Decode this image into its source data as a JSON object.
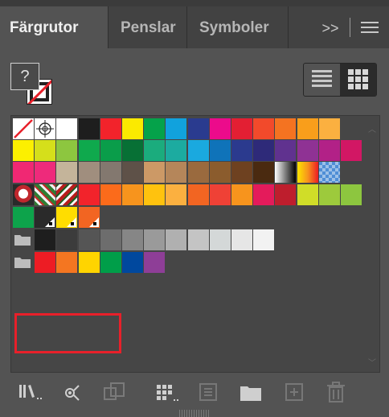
{
  "tabs": [
    {
      "label": "Färgrutor",
      "active": true
    },
    {
      "label": "Penslar",
      "active": false
    },
    {
      "label": "Symboler",
      "active": false
    }
  ],
  "overflow_label": ">>",
  "fill_stroke": {
    "unknown_fill_label": "?"
  },
  "view": {
    "list": "list-view-icon",
    "grid": "grid-view-icon",
    "selected": "grid"
  },
  "swatch_rows": [
    [
      "#none",
      "#registration",
      "#ffffff",
      "#1e1e1e",
      "#f2232b",
      "#fbea00",
      "#05a24a",
      "#11a2dd",
      "#2a3b8f",
      "#ec0b8b",
      "#e31f33",
      "#f24a2b",
      "#f47321",
      "#f99e1b",
      "#fbb040"
    ],
    [
      "#fcf000",
      "#d5df1b",
      "#8dc63f",
      "#0fa94d",
      "#0a9d4a",
      "#077035",
      "#1bac7d",
      "#1caba0",
      "#1aa9df",
      "#0f73b9",
      "#2b3a8e",
      "#2e2a79",
      "#60328f",
      "#8f3294",
      "#b22187",
      "#d21764"
    ],
    [
      "#f02873",
      "#ee2a7b",
      "#c4b49a",
      "#a08e7e",
      "#83786f",
      "#5e5148",
      "#cc9966",
      "#b5865a",
      "#9a6a3e",
      "#8b5c2d",
      "#6e4120",
      "#4a2a10",
      "#gradient-bw",
      "#gradient-orange",
      "#transparency"
    ],
    [
      "#pattern-1",
      "#pattern-2",
      "#pattern-3",
      "#f2232b",
      "#fb6b1b",
      "#f7941d",
      "#ffc20e",
      "#fbb040",
      "#f26522",
      "#ef4136",
      "#f7941d",
      "#e41b5b",
      "#be1e2d",
      "#d0dd28",
      "#9dca3c",
      "#8dc63f"
    ]
  ],
  "tint_group": [
    "#0da34b",
    "#2a2a2a",
    "#ffdd00",
    "#f26522"
  ],
  "gray_group": [
    "#1e1e1e",
    "#3c3c3c",
    "#555555",
    "#6d6d6d",
    "#868686",
    "#9a9a9a",
    "#b0b0b0",
    "#c4c4c4",
    "#d4d8d8",
    "#e6e6e6",
    "#f2f2f2"
  ],
  "bright_group": [
    "#ed1c24",
    "#f47621",
    "#ffd400",
    "#009e49",
    "#00489e",
    "#8e3e97"
  ],
  "bottom_icons": [
    "swatch-libraries-icon",
    "show-kinds-icon",
    "place-swatches-icon",
    "new-color-group-icon",
    "swatch-options-icon",
    "new-folder-icon",
    "new-swatch-icon",
    "delete-swatch-icon"
  ]
}
